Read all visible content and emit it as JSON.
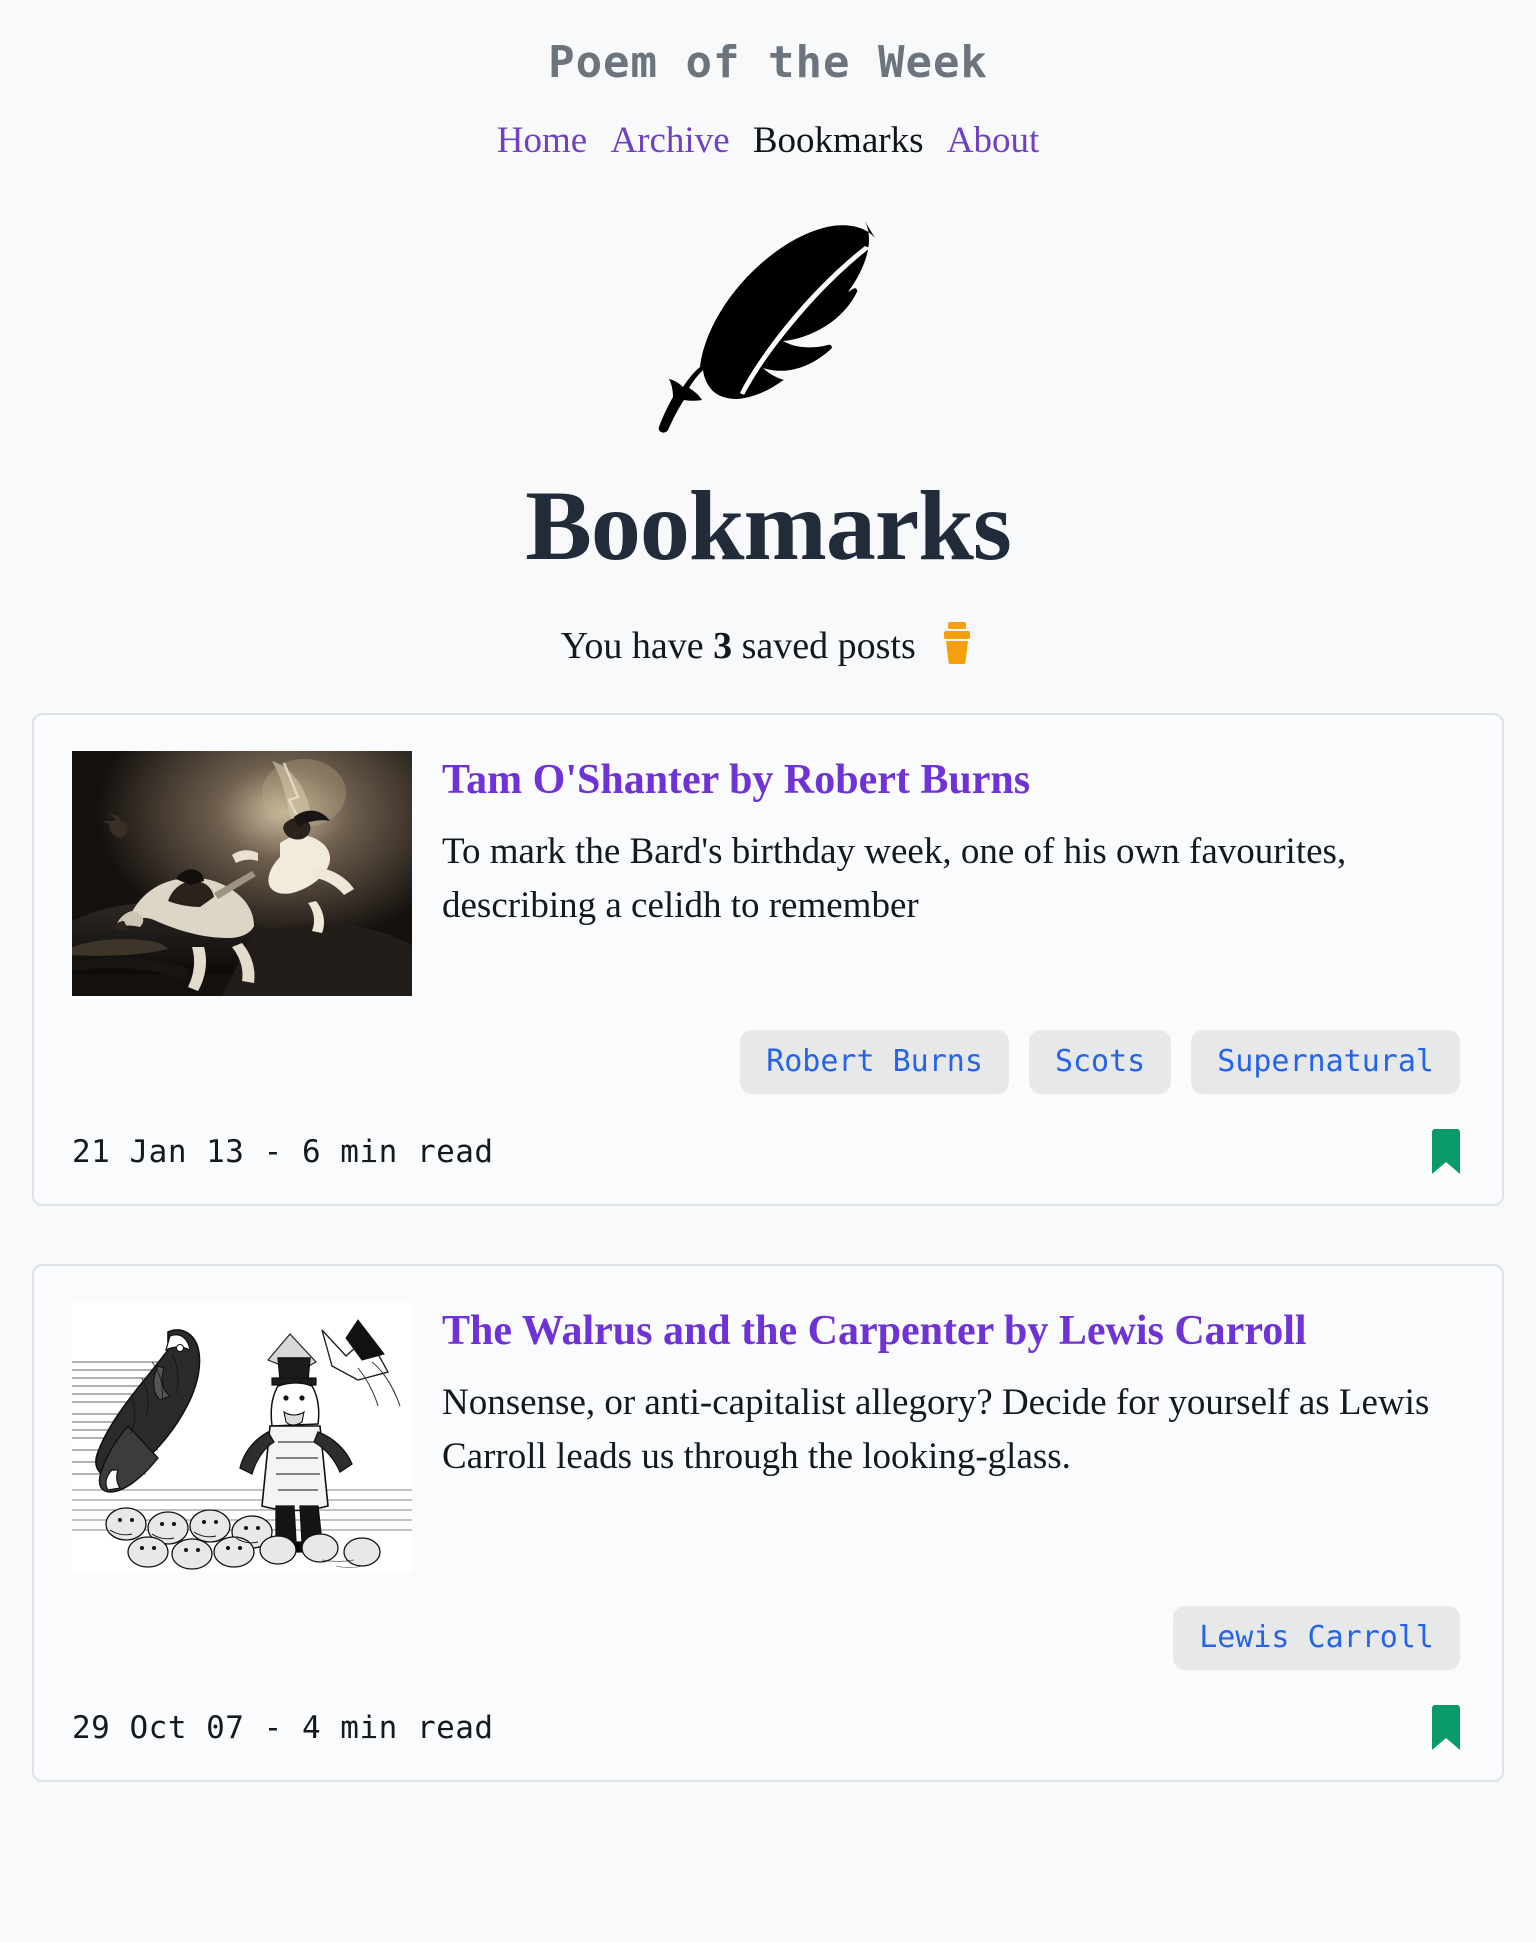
{
  "site": {
    "title": "Poem of the Week",
    "logo_icon": "feather-icon",
    "brand_color": "#6f42c1"
  },
  "nav": {
    "items": [
      {
        "label": "Home",
        "current": false
      },
      {
        "label": "Archive",
        "current": false
      },
      {
        "label": "Bookmarks",
        "current": true
      },
      {
        "label": "About",
        "current": false
      }
    ]
  },
  "page": {
    "heading": "Bookmarks",
    "count_prefix": "You have",
    "count": "3",
    "count_suffix": "saved posts",
    "clear_icon": "trash-icon",
    "clear_icon_color": "#f59f0b"
  },
  "posts": [
    {
      "title": "Tam O'Shanter by Robert Burns",
      "excerpt": "To mark the Bard's birthday week, one of his own favourites, describing a celidh to remember",
      "tags": [
        "Robert Burns",
        "Scots",
        "Supernatural"
      ],
      "date": "21 Jan 13",
      "read_time": "6 min read",
      "meta": "21 Jan 13 - 6 min read",
      "bookmark_icon": "bookmark-filled-icon",
      "bookmark_color": "#0a9a68",
      "thumbnail_alt": "Tam O'Shanter fleeing on horseback pursued by a witch"
    },
    {
      "title": "The Walrus and the Carpenter by Lewis Carroll",
      "excerpt": "Nonsense, or anti-capitalist allegory? Decide for yourself as Lewis Carroll leads us through the looking-glass.",
      "tags": [
        "Lewis Carroll"
      ],
      "date": "29 Oct 07",
      "read_time": "4 min read",
      "meta": "29 Oct 07 - 4 min read",
      "bookmark_icon": "bookmark-filled-icon",
      "bookmark_color": "#0a9a68",
      "thumbnail_alt": "Tenniel engraving of the Walrus and the Carpenter with oysters"
    }
  ]
}
